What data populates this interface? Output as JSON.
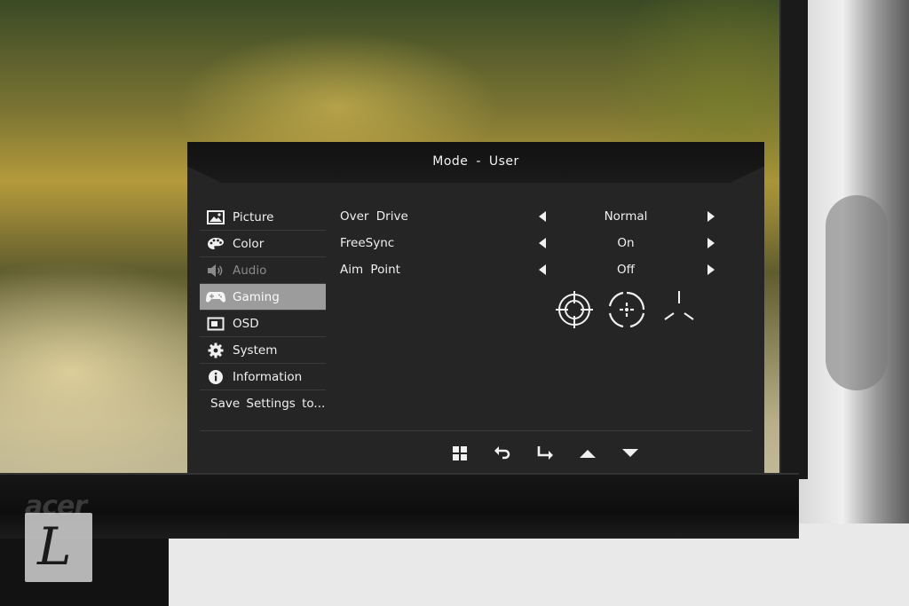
{
  "osd": {
    "title": "Mode - User",
    "sidebar": [
      {
        "label": "Picture",
        "icon": "picture-icon",
        "state": "normal"
      },
      {
        "label": "Color",
        "icon": "palette-icon",
        "state": "normal"
      },
      {
        "label": "Audio",
        "icon": "speaker-icon",
        "state": "disabled"
      },
      {
        "label": "Gaming",
        "icon": "gamepad-icon",
        "state": "selected"
      },
      {
        "label": "OSD",
        "icon": "osd-window-icon",
        "state": "normal"
      },
      {
        "label": "System",
        "icon": "gear-icon",
        "state": "normal"
      },
      {
        "label": "Information",
        "icon": "info-icon",
        "state": "normal"
      },
      {
        "label": "Save Settings to...",
        "icon": "",
        "state": "normal"
      }
    ],
    "settings": [
      {
        "label": "Over Drive",
        "value": "Normal"
      },
      {
        "label": "FreeSync",
        "value": "On"
      },
      {
        "label": "Aim Point",
        "value": "Off"
      }
    ],
    "aim_point_options": [
      "crosshair-circle-icon",
      "crosshair-dot-icon",
      "crosshair-tri-icon"
    ],
    "footer_buttons": [
      "menu-icon",
      "back-icon",
      "enter-icon",
      "up-arrow-icon",
      "down-arrow-icon"
    ]
  },
  "brand": {
    "logo_text": "acer",
    "watermark_text": "L"
  },
  "colors": {
    "selected_bg": "#9c9c9c",
    "panel_bg": "#252525",
    "text": "#f0f0f0",
    "disabled_text": "#8a8a8a"
  }
}
